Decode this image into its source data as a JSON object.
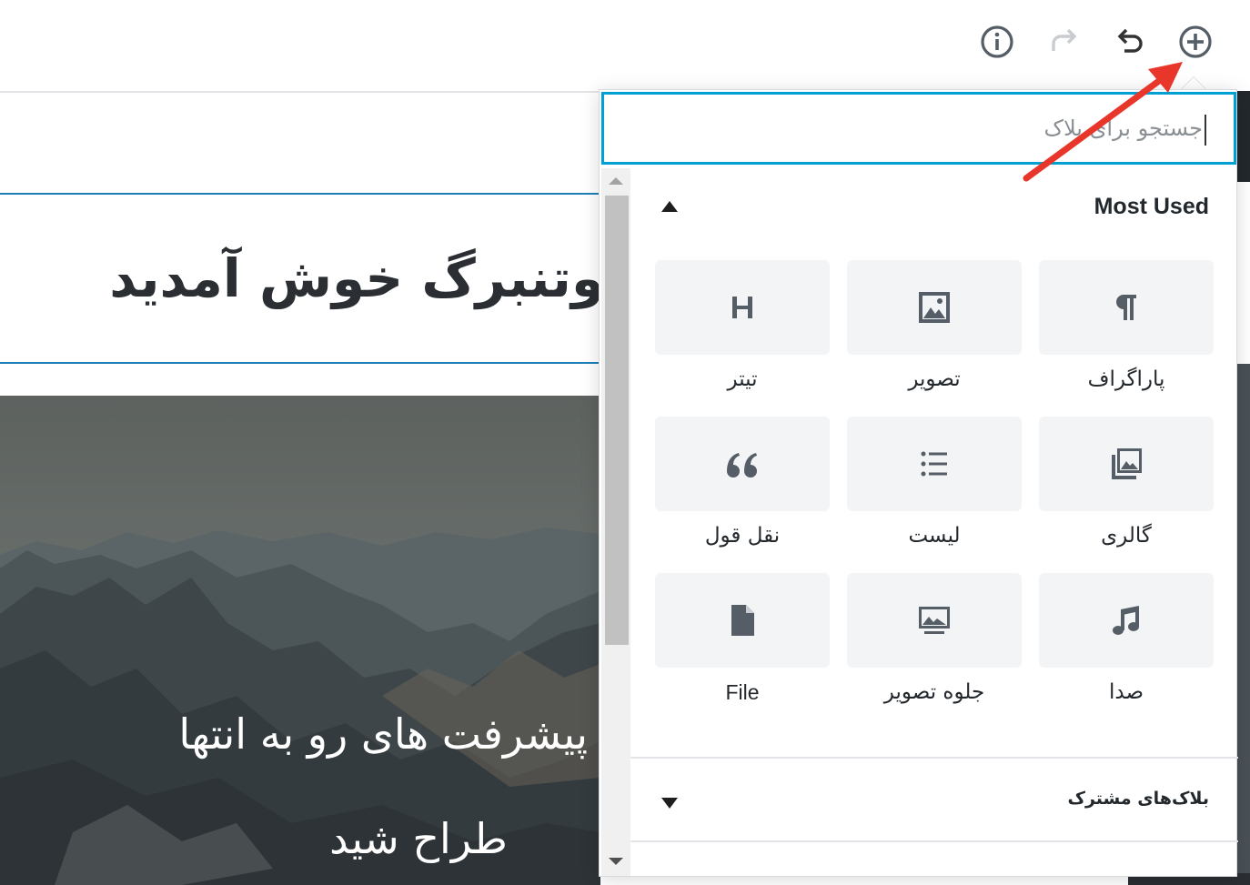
{
  "toolbar": {
    "buttons": [
      {
        "name": "info-button",
        "icon": "info-icon"
      },
      {
        "name": "redo-button",
        "icon": "redo-icon"
      },
      {
        "name": "undo-button",
        "icon": "undo-icon"
      },
      {
        "name": "add-block-button",
        "icon": "plus-circle-icon"
      }
    ]
  },
  "editor": {
    "title": "وتنبرگ خوش آمدید",
    "cover": {
      "line1": "پیشرفت های رو به انتها",
      "line2": "طراح شید"
    }
  },
  "inserter": {
    "search": {
      "placeholder": "جستجو برای بلاک",
      "value": ""
    },
    "most_used": {
      "title": "Most Used",
      "blocks": [
        {
          "label": "پاراگراف",
          "icon": "paragraph-icon"
        },
        {
          "label": "تصویر",
          "icon": "image-icon"
        },
        {
          "label": "تیتر",
          "icon": "heading-icon"
        },
        {
          "label": "گالری",
          "icon": "gallery-icon"
        },
        {
          "label": "لیست",
          "icon": "list-icon"
        },
        {
          "label": "نقل قول",
          "icon": "quote-icon"
        },
        {
          "label": "صدا",
          "icon": "audio-icon"
        },
        {
          "label": "جلوه تصویر",
          "icon": "cover-image-icon"
        },
        {
          "label": "File",
          "icon": "file-icon"
        }
      ]
    },
    "shared": {
      "title": "بلاک‌های مشترک"
    }
  },
  "colors": {
    "accent": "#00a0d2",
    "title_border": "#1e7fb8",
    "tile_bg": "#f3f4f5",
    "annotation": "#e8362b"
  }
}
